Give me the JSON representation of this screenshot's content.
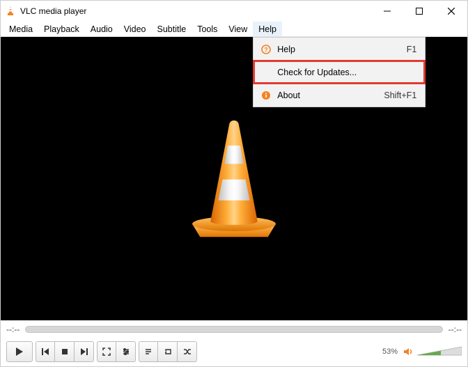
{
  "window": {
    "title": "VLC media player"
  },
  "menus": {
    "media": "Media",
    "playback": "Playback",
    "audio": "Audio",
    "video": "Video",
    "subtitle": "Subtitle",
    "tools": "Tools",
    "view": "View",
    "help": "Help"
  },
  "help_menu": {
    "help": {
      "label": "Help",
      "accel": "F1"
    },
    "check_updates": {
      "label": "Check for Updates..."
    },
    "about": {
      "label": "About",
      "accel": "Shift+F1"
    }
  },
  "time": {
    "elapsed": "--:--",
    "remaining": "--:--"
  },
  "volume": {
    "percent": "53%"
  }
}
